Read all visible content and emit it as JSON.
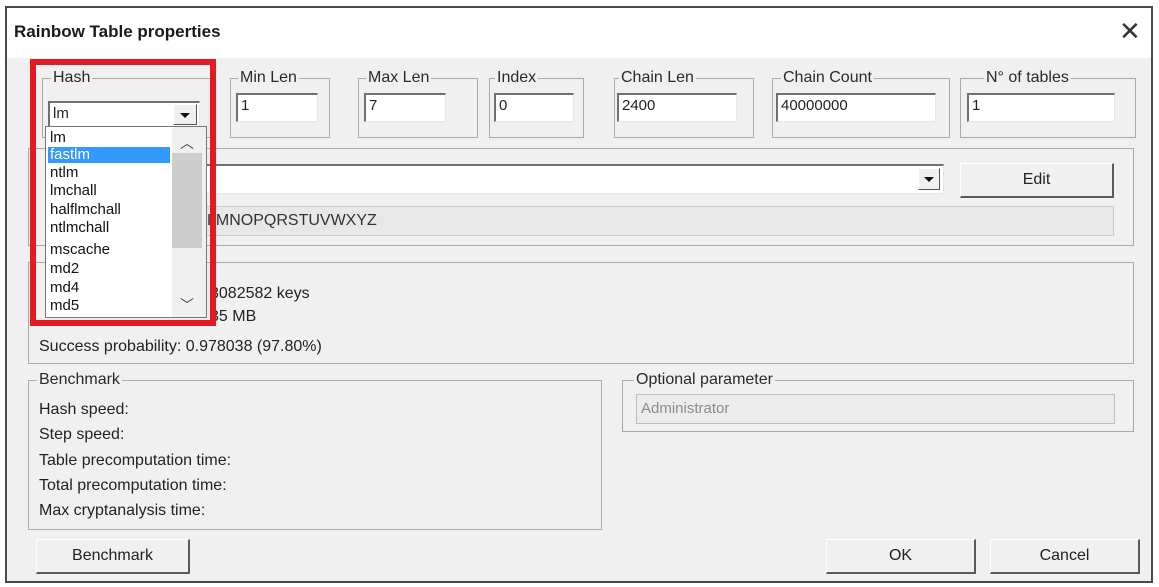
{
  "window": {
    "title": "Rainbow Table properties",
    "close_glyph": "✕"
  },
  "hash": {
    "label": "Hash",
    "value": "lm",
    "options": [
      "lm",
      "fastlm",
      "ntlm",
      "lmchall",
      "halflmchall",
      "ntlmchall",
      "mscache",
      "md2",
      "md4",
      "md5"
    ],
    "selected_index": 1
  },
  "fields": {
    "min_len": {
      "label": "Min Len",
      "value": "1"
    },
    "max_len": {
      "label": "Max Len",
      "value": "7"
    },
    "index": {
      "label": "Index",
      "value": "0"
    },
    "chain_len": {
      "label": "Chain Len",
      "value": "2400"
    },
    "chain_count": {
      "label": "Chain Count",
      "value": "40000000"
    },
    "n_tables": {
      "label": "N° of tables",
      "value": "1"
    }
  },
  "charset": {
    "value": "",
    "preview": "LMNOPQRSTUVWXYZ",
    "edit_label": "Edit"
  },
  "stats": {
    "keyspace_partial": "3082582 keys",
    "disk_partial": "35 MB",
    "success": "Success probability: 0.978038 (97.80%)"
  },
  "benchmark": {
    "label": "Benchmark",
    "rows": [
      "Hash speed:",
      "Step speed:",
      "Table precomputation time:",
      "Total precomputation time:",
      "Max cryptanalysis time:"
    ]
  },
  "optional": {
    "label": "Optional parameter",
    "value": "Administrator"
  },
  "buttons": {
    "benchmark": "Benchmark",
    "ok": "OK",
    "cancel": "Cancel"
  },
  "colors": {
    "highlight_box": "#e01b24",
    "selection": "#3399ff"
  }
}
